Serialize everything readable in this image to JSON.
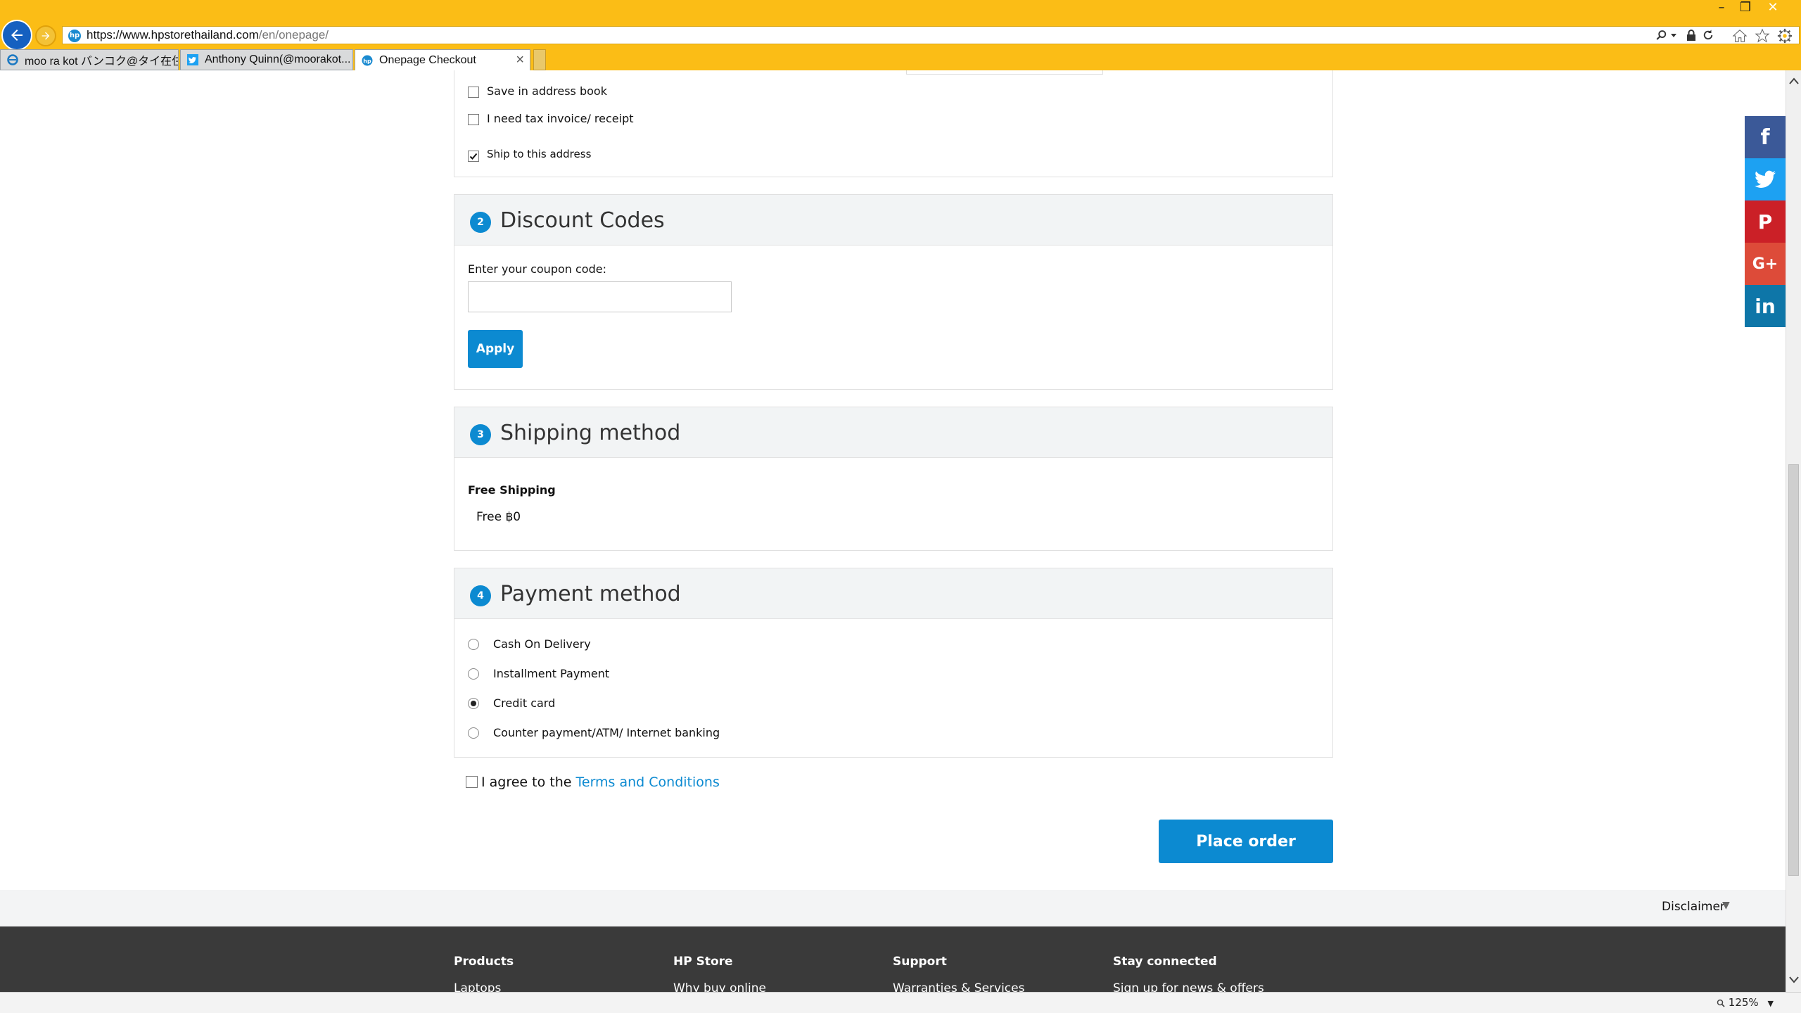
{
  "browser": {
    "url_host": "https://www.hpstorethailand.com",
    "url_path": "/en/onepage/",
    "tabs": [
      {
        "label": "moo ra kot バンコク@タイ在住..."
      },
      {
        "label": "Anthony Quinn(@moorakot..."
      },
      {
        "label": "Onepage Checkout"
      }
    ],
    "tab_close": "×",
    "window_controls": {
      "minimize": "–",
      "restore": "❐",
      "close": "✕"
    },
    "zoom_label": "125%",
    "accent_color": "#fbbd16"
  },
  "address": {
    "save_label": "Save in address book",
    "tax_label": "I need tax invoice/ receipt",
    "ship_label": "Ship to this address"
  },
  "discount": {
    "step": "2",
    "title": "Discount Codes",
    "coupon_label": "Enter your coupon code:",
    "coupon_value": "",
    "apply_label": "Apply"
  },
  "shipping": {
    "step": "3",
    "title": "Shipping method",
    "method_name": "Free Shipping",
    "method_price": "Free ฿0"
  },
  "payment": {
    "step": "4",
    "title": "Payment method",
    "options": [
      {
        "label": "Cash On Delivery"
      },
      {
        "label": "Installment Payment"
      },
      {
        "label": "Credit card"
      },
      {
        "label": "Counter payment/ATM/ Internet banking"
      }
    ],
    "selected": "Credit card"
  },
  "terms": {
    "prefix": "I agree to the ",
    "link": "Terms and Conditions"
  },
  "place_order_label": "Place order",
  "disclaimer": {
    "label": "Disclaimer",
    "caret": "▼"
  },
  "footer": {
    "columns": [
      {
        "heading": "Products",
        "link": "Laptops"
      },
      {
        "heading": "HP Store",
        "link": "Why buy online"
      },
      {
        "heading": "Support",
        "link": "Warranties & Services"
      },
      {
        "heading": "Stay connected",
        "link": "Sign up for news & offers"
      }
    ]
  },
  "social": {
    "facebook": {
      "glyph": "f",
      "color": "#3b5998"
    },
    "twitter": {
      "color": "#1da1f2"
    },
    "pinterest": {
      "glyph": "P",
      "color": "#cb2027"
    },
    "googleplus": {
      "glyph": "G+",
      "color": "#dd4b39"
    },
    "linkedin": {
      "glyph": "in",
      "color": "#0e76a8"
    }
  }
}
